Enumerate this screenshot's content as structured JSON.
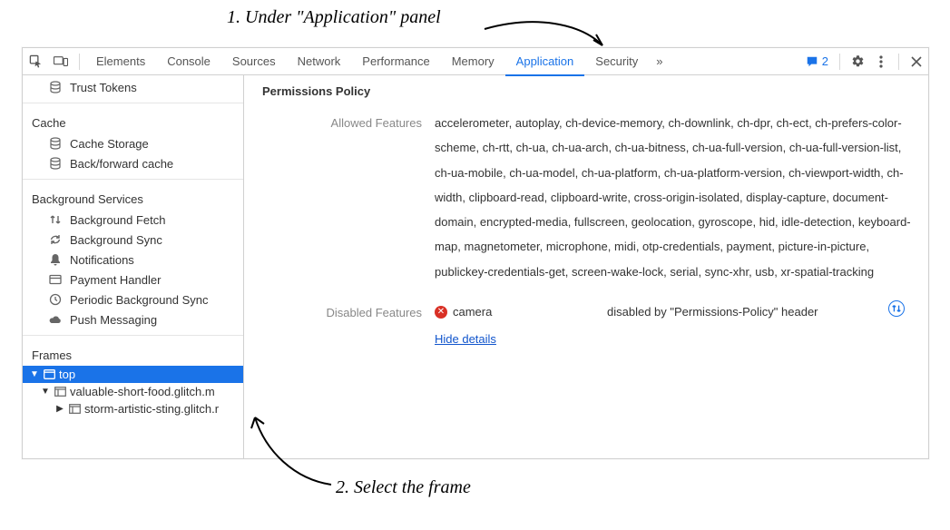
{
  "annotations": {
    "step1": "1. Under \"Application\" panel",
    "step2": "2. Select the frame"
  },
  "toolbar": {
    "tabs": [
      "Elements",
      "Console",
      "Sources",
      "Network",
      "Performance",
      "Memory",
      "Application",
      "Security"
    ],
    "active_tab": "Application",
    "issues_count": "2"
  },
  "sidebar": {
    "pre_item": "Trust Tokens",
    "groups": [
      {
        "title": "Cache",
        "items": [
          {
            "icon": "database",
            "label": "Cache Storage"
          },
          {
            "icon": "database",
            "label": "Back/forward cache"
          }
        ]
      },
      {
        "title": "Background Services",
        "items": [
          {
            "icon": "updown",
            "label": "Background Fetch"
          },
          {
            "icon": "sync",
            "label": "Background Sync"
          },
          {
            "icon": "bell",
            "label": "Notifications"
          },
          {
            "icon": "card",
            "label": "Payment Handler"
          },
          {
            "icon": "clock",
            "label": "Periodic Background Sync"
          },
          {
            "icon": "cloud",
            "label": "Push Messaging"
          }
        ]
      }
    ],
    "frames_title": "Frames",
    "frames": {
      "top": "top",
      "child1": "valuable-short-food.glitch.m",
      "child2": "storm-artistic-sting.glitch.r"
    }
  },
  "content": {
    "section_title": "Permissions Policy",
    "allowed_label": "Allowed Features",
    "allowed_value": "accelerometer, autoplay, ch-device-memory, ch-downlink, ch-dpr, ch-ect, ch-prefers-color-scheme, ch-rtt, ch-ua, ch-ua-arch, ch-ua-bitness, ch-ua-full-version, ch-ua-full-version-list, ch-ua-mobile, ch-ua-model, ch-ua-platform, ch-ua-platform-version, ch-viewport-width, ch-width, clipboard-read, clipboard-write, cross-origin-isolated, display-capture, document-domain, encrypted-media, fullscreen, geolocation, gyroscope, hid, idle-detection, keyboard-map, magnetometer, microphone, midi, otp-credentials, payment, picture-in-picture, publickey-credentials-get, screen-wake-lock, serial, sync-xhr, usb, xr-spatial-tracking",
    "disabled_label": "Disabled Features",
    "disabled_feature": "camera",
    "disabled_reason": "disabled by \"Permissions-Policy\" header",
    "hide_details": "Hide details"
  }
}
